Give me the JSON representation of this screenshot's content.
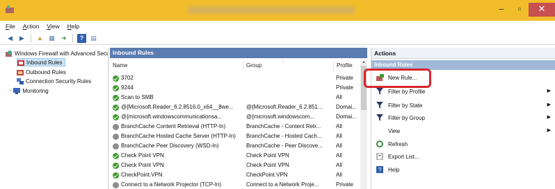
{
  "menu": [
    "File",
    "Action",
    "View",
    "Help"
  ],
  "tree": {
    "root": "Windows Firewall with Advanced Security",
    "inbound": "Inbound Rules",
    "outbound": "Outbound Rules",
    "connsec": "Connection Security Rules",
    "monitoring": "Monitoring"
  },
  "middle": {
    "title": "Inbound Rules",
    "columns": {
      "name": "Name",
      "group": "Group",
      "profile": "Profile"
    },
    "rows": [
      {
        "name": "3702",
        "group": "",
        "profile": "Private",
        "icon": "green-check"
      },
      {
        "name": "9244",
        "group": "",
        "profile": "Private",
        "icon": "green-check"
      },
      {
        "name": "Scan to SMB",
        "group": "",
        "profile": "All",
        "icon": "green-check"
      },
      {
        "name": "@{Microsoft.Reader_6.2.8516.0_x64__8we...",
        "group": "@{Microsoft.Reader_6.2.851...",
        "profile": "Domai...",
        "icon": "green-check"
      },
      {
        "name": "@{microsoft.windowscommunicationsa...",
        "group": "@{microsoft.windowscom...",
        "profile": "Domai...",
        "icon": "green-check"
      },
      {
        "name": "BranchCache Content Retrieval (HTTP-In)",
        "group": "BranchCache - Content Retr...",
        "profile": "All",
        "icon": "gray"
      },
      {
        "name": "BranchCache Hosted Cache Server (HTTP-In)",
        "group": "BranchCache - Hosted Cach...",
        "profile": "All",
        "icon": "gray"
      },
      {
        "name": "BranchCache Peer Discovery (WSD-In)",
        "group": "BranchCache - Peer Discove...",
        "profile": "All",
        "icon": "gray"
      },
      {
        "name": "Check Point VPN",
        "group": "Check Point VPN",
        "profile": "All",
        "icon": "green-check"
      },
      {
        "name": "Check Point VPN",
        "group": "Check Point VPN",
        "profile": "All",
        "icon": "green-check"
      },
      {
        "name": "CheckPoint.VPN",
        "group": "CheckPoint.VPN",
        "profile": "All",
        "icon": "green-check"
      },
      {
        "name": "Connect to a Network Projector (TCP-In)",
        "group": "Connect to a Network Proje...",
        "profile": "Private",
        "icon": "gray"
      }
    ]
  },
  "actions": {
    "title": "Actions",
    "subtitle": "Inbound Rules",
    "items": [
      {
        "label": "New Rule...",
        "icon": "new-rule-icon",
        "arrow": false
      },
      {
        "label": "Filter by Profile",
        "icon": "filter-icon",
        "arrow": true
      },
      {
        "label": "Filter by State",
        "icon": "filter-icon",
        "arrow": true
      },
      {
        "label": "Filter by Group",
        "icon": "filter-icon",
        "arrow": true
      },
      {
        "label": "View",
        "icon": "",
        "arrow": true
      },
      {
        "label": "Refresh",
        "icon": "refresh-icon",
        "arrow": false
      },
      {
        "label": "Export List...",
        "icon": "export-icon",
        "arrow": false
      },
      {
        "label": "Help",
        "icon": "help-icon",
        "arrow": false
      }
    ]
  },
  "colors": {
    "titlebar": "#f1bd2a",
    "pane_header": "#5a7cb0",
    "highlight": "#d6242a"
  }
}
